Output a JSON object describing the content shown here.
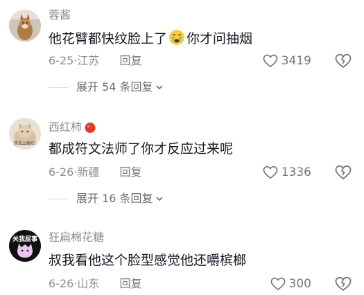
{
  "comments": [
    {
      "username": "蓉酱",
      "text_before": "他花臂都快纹脸上了",
      "text_after": "你才问抽烟",
      "emoji": "crying-face-icon",
      "date": "6-25",
      "location": "江苏",
      "reply_label": "回复",
      "likes": "3419",
      "expand_label": "展开 54 条回复"
    },
    {
      "username": "西红柿",
      "username_emoji": "tomato-icon",
      "text": "都成符文法师了你才反应过来呢",
      "avatar_caption": "想法上线拉!",
      "date": "6-26",
      "location": "新疆",
      "reply_label": "回复",
      "likes": "1336",
      "expand_label": "展开 16 条回复"
    },
    {
      "username": "狂扁棉花糖",
      "text": "叔我看他这个脸型感觉他还嚼槟榔",
      "avatar_caption": "关我屁事",
      "date": "6-26",
      "location": "山东",
      "reply_label": "回复",
      "likes": "300"
    }
  ],
  "colors": {
    "primary_text": "#161823",
    "secondary_text": "#8a8b91",
    "background": "#ffffff"
  }
}
